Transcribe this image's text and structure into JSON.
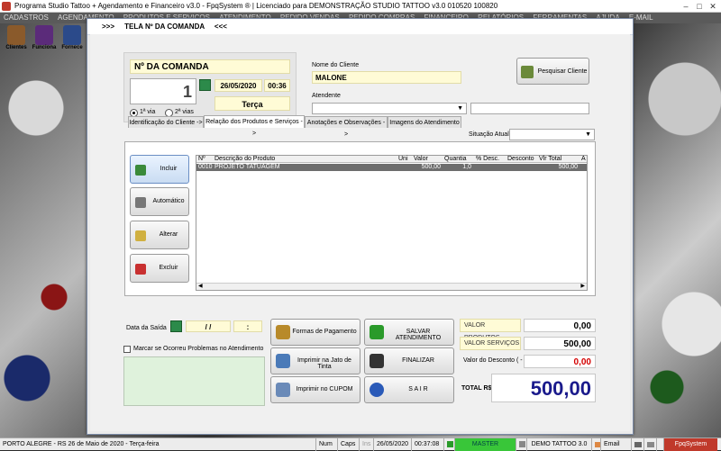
{
  "window": {
    "title": "Programa Studio Tattoo + Agendamento e Financeiro v3.0 - FpqSystem ® | Licenciado para  DEMONSTRAÇÃO STUDIO TATTOO v3.0 010520 100820"
  },
  "menu": [
    "CADASTROS",
    "AGENDAMENTO",
    "PRODUTOS E SERVIÇOS",
    "ATENDIMENTO",
    "PEDIDO VENDAS",
    "PEDIDO COMPRAS",
    "FINANCEIRO",
    "RELATÓRIOS",
    "FERRAMENTAS",
    "AJUDA",
    "E-MAIL"
  ],
  "toolbar": [
    {
      "label": "Clientes",
      "icon": "clients-icon",
      "color": "#8a5a2b"
    },
    {
      "label": "Funciona",
      "icon": "employees-icon",
      "color": "#5b2b7a"
    },
    {
      "label": "Fornece",
      "icon": "supplier-icon",
      "color": "#2b4a8a"
    }
  ],
  "dialog": {
    "title": ">>>     TELA Nº DA COMANDA     <<<"
  },
  "comanda": {
    "header": "Nº DA COMANDA",
    "number": "1",
    "date": "26/05/2020",
    "time": "00:36",
    "weekday": "Terça",
    "via1": "1ª via",
    "via2": "2ª vias"
  },
  "client": {
    "label": "Nome do Cliente",
    "name": "MALONE",
    "search_button": "Pesquisar Cliente",
    "attendant_label": "Atendente",
    "attendant_value": "",
    "extra_value": ""
  },
  "tabs": [
    "Identificação do Cliente ->",
    "Relação dos Produtos e Serviços ->",
    "Anotações e Observações ->",
    "Imagens do Atendimento"
  ],
  "situation": {
    "label": "Situação Atual",
    "value": ""
  },
  "side_buttons": [
    "Incluir",
    "Automático",
    "Alterar",
    "Excluir"
  ],
  "grid": {
    "columns": [
      "Nº",
      "Descrição do Produto",
      "Uni",
      "Valor",
      "Quantia",
      "% Desc.",
      "Desconto",
      "Vlr Total",
      "A"
    ],
    "rows": [
      {
        "num": "0010",
        "desc": "PROJETO TATUAGEM",
        "uni": "",
        "valor": "500,00",
        "quantia": "1,0",
        "pdesc": "",
        "desconto": "",
        "total": "500,00"
      }
    ]
  },
  "exit": {
    "label": "Data da Saída",
    "date": "/ /",
    "time": ":"
  },
  "problem_check": "Marcar se Ocorreu Problemas no Atendimento",
  "actions": [
    {
      "label": "Formas de Pagamento",
      "icon": "coins-icon"
    },
    {
      "label": "SALVAR  ATENDIMENTO",
      "icon": "check-icon"
    },
    {
      "label": "Imprimir na Jato de Tinta",
      "icon": "printer-icon"
    },
    {
      "label": "FINALIZAR",
      "icon": "finalize-icon"
    },
    {
      "label": "Imprimir no CUPOM",
      "icon": "receipt-printer-icon"
    },
    {
      "label": "S A I R",
      "icon": "exit-icon"
    }
  ],
  "totals": {
    "produtos_label": "VALOR PRODUTOS",
    "produtos": "0,00",
    "servicos_label": "VALOR SERVIÇOS",
    "servicos": "500,00",
    "desconto_label": "Valor do Desconto ( - )",
    "desconto": "0,00",
    "total_label": "TOTAL R$",
    "total": "500,00",
    "discount_color": "#d40000",
    "total_color": "#1a1a8c"
  },
  "status": {
    "location": "PORTO ALEGRE - RS 26 de Maio de 2020 - Terça-feira",
    "num": "Num",
    "caps": "Caps",
    "ins": "Ins",
    "date": "26/05/2020",
    "time": "00:37:08",
    "master": "MASTER",
    "demo": "DEMO TATTOO 3.0",
    "email": "Email",
    "brand": "FpqSystem"
  }
}
